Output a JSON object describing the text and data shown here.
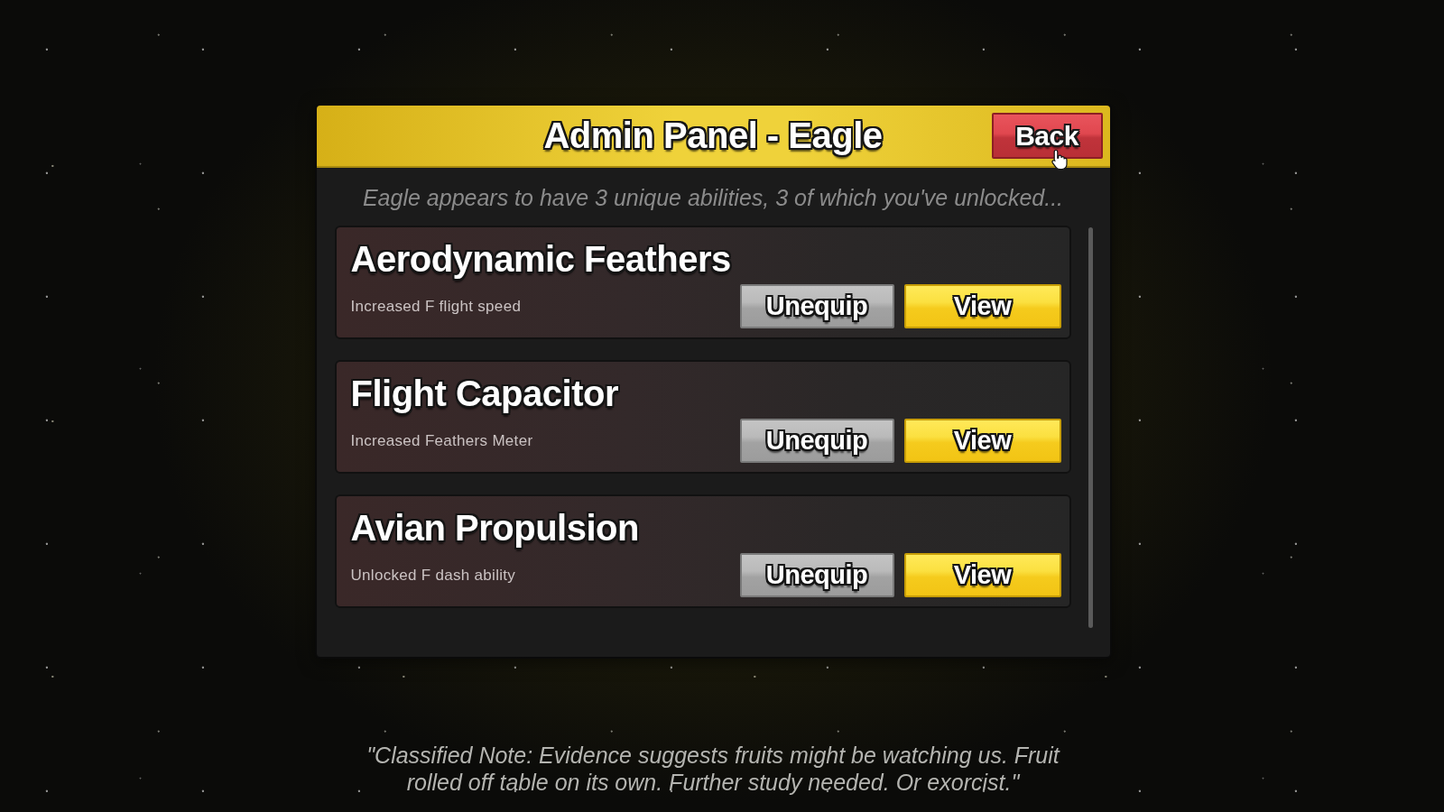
{
  "panel": {
    "title": "Admin Panel - Eagle",
    "back_button": "Back",
    "subtitle": "Eagle appears to have 3 unique abilities, 3 of which you've unlocked...",
    "abilities": [
      {
        "name": "Aerodynamic Feathers",
        "description": "Increased F flight speed",
        "buttons": [
          {
            "label": "Unequip",
            "kind": "unequip"
          },
          {
            "label": "View",
            "kind": "view"
          }
        ]
      },
      {
        "name": "Flight Capacitor",
        "description": "Increased Feathers Meter",
        "buttons": [
          {
            "label": "Unequip",
            "kind": "unequip"
          },
          {
            "label": "View",
            "kind": "view"
          }
        ]
      },
      {
        "name": "Avian Propulsion",
        "description": "Unlocked F dash ability",
        "buttons": [
          {
            "label": "Unequip",
            "kind": "unequip"
          },
          {
            "label": "View",
            "kind": "view"
          }
        ]
      }
    ]
  },
  "note": "\"Classified Note: Evidence suggests fruits might be watching us. Fruit rolled off table on its own. Further study needed. Or exorcist.\""
}
